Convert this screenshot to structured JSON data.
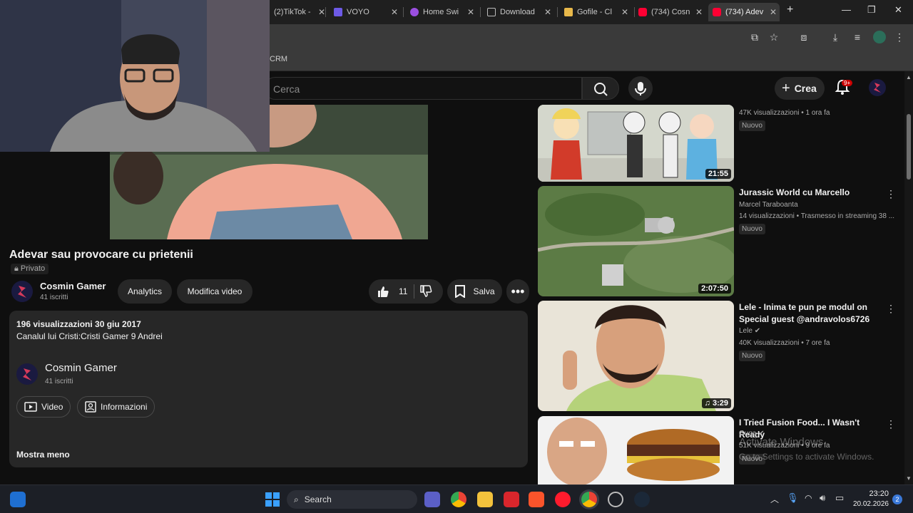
{
  "browser": {
    "tabs": [
      {
        "label": "(2)TikTok -",
        "color": "#25f4ee"
      },
      {
        "label": "VOYO",
        "color": "#7b61ff"
      },
      {
        "label": "Home Swi",
        "color": "#a855f7"
      },
      {
        "label": "Download",
        "color": "#bbbbbb"
      },
      {
        "label": "Gofile - Cl",
        "color": "#e8b84a"
      },
      {
        "label": "(734) Cosn",
        "color": "#ff0033"
      },
      {
        "label": "(734) Adev",
        "color": "#ff0033"
      }
    ],
    "bookmark_label": "CRM"
  },
  "youtube": {
    "search_placeholder": "Cerca",
    "create_label": "Crea",
    "notification_count": "9+",
    "accent": "#ff0033"
  },
  "video": {
    "title": "Adevar sau provocare cu prietenii",
    "privacy": "Privato",
    "channel_name": "Cosmin Gamer",
    "subscribers": "41 iscritti",
    "analytics_label": "Analytics",
    "edit_label": "Modifica video",
    "likes": "11",
    "save_label": "Salva"
  },
  "description": {
    "stats": "196 visualizzazioni  30 giu 2017",
    "text": "Canalul lui Cristi:Cristi Gamer 9 Andrei",
    "channel_name": "Cosmin Gamer",
    "subscribers": "41 iscritti",
    "video_label": "Video",
    "info_label": "Informazioni",
    "show_less": "Mostra meno"
  },
  "recommendations": [
    {
      "title": "",
      "channel": "",
      "meta": "47K visualizzazioni • 1 ora fa",
      "badge": "Nuovo",
      "duration": "21:55"
    },
    {
      "title": "Jurassic World cu Marcello",
      "channel": "Marcel Taraboanta",
      "meta": "14 visualizzazioni • Trasmesso in streaming 38 ...",
      "badge": "Nuovo",
      "duration": "2:07:50"
    },
    {
      "title": "Lele - Inima te pun pe modul on Special guest @andravolos6726",
      "channel": "Lele",
      "meta": "40K visualizzazioni • 7 ore fa",
      "badge": "Nuovo",
      "duration": "3:29"
    },
    {
      "title": "I Tried Fusion Food... I Wasn't Ready",
      "channel": "Guga",
      "meta": "51K visualizzazioni • 9 ore fa",
      "badge": "Nuovo",
      "duration": ""
    }
  ],
  "watermark": {
    "line1": "Activate Windows",
    "line2": "Go to Settings to activate Windows."
  },
  "taskbar": {
    "search_label": "Search",
    "time": "23:20",
    "date": "20.02.2026",
    "notif_count": "2"
  }
}
